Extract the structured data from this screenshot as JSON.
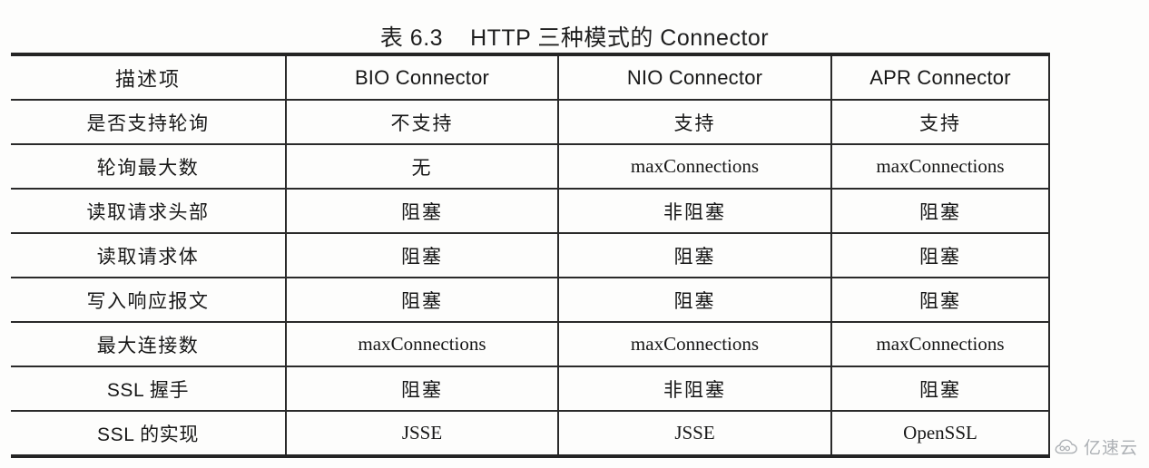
{
  "caption": {
    "number": "表 6.3",
    "text": "HTTP 三种模式的 Connector"
  },
  "table": {
    "headers": [
      "描述项",
      "BIO Connector",
      "NIO Connector",
      "APR Connector"
    ],
    "rows": [
      {
        "label": "是否支持轮询",
        "bio": "不支持",
        "nio": "支持",
        "apr": "支持"
      },
      {
        "label": "轮询最大数",
        "bio": "无",
        "nio": "maxConnections",
        "apr": "maxConnections"
      },
      {
        "label": "读取请求头部",
        "bio": "阻塞",
        "nio": "非阻塞",
        "apr": "阻塞"
      },
      {
        "label": "读取请求体",
        "bio": "阻塞",
        "nio": "阻塞",
        "apr": "阻塞"
      },
      {
        "label": "写入响应报文",
        "bio": "阻塞",
        "nio": "阻塞",
        "apr": "阻塞"
      },
      {
        "label": "最大连接数",
        "bio": "maxConnections",
        "nio": "maxConnections",
        "apr": "maxConnections"
      },
      {
        "label": "SSL 握手",
        "bio": "阻塞",
        "nio": "非阻塞",
        "apr": "阻塞"
      },
      {
        "label": "SSL 的实现",
        "bio": "JSSE",
        "nio": "JSSE",
        "apr": "OpenSSL"
      }
    ]
  },
  "watermark": {
    "text": "亿速云",
    "icon": "cloud-icon",
    "color": "#8e9399"
  }
}
